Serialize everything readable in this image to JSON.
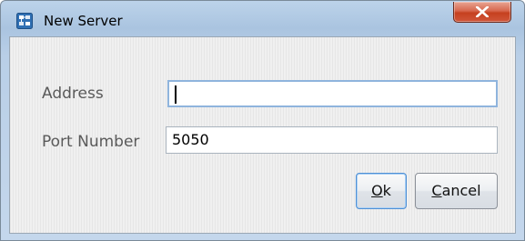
{
  "window": {
    "title": "New Server",
    "close_symbol": "X",
    "icon": "network-server-icon"
  },
  "form": {
    "address": {
      "label": "Address",
      "value": ""
    },
    "port": {
      "label": "Port Number",
      "value": "5050"
    }
  },
  "buttons": {
    "ok": {
      "mnemonic": "O",
      "rest": "k"
    },
    "cancel": {
      "mnemonic": "C",
      "rest": "ancel"
    }
  },
  "colors": {
    "title_bar": "#aac4e0",
    "close_button": "#c5401f",
    "focus_border": "#8fb4dd",
    "default_button_border": "#4f8fd4"
  }
}
